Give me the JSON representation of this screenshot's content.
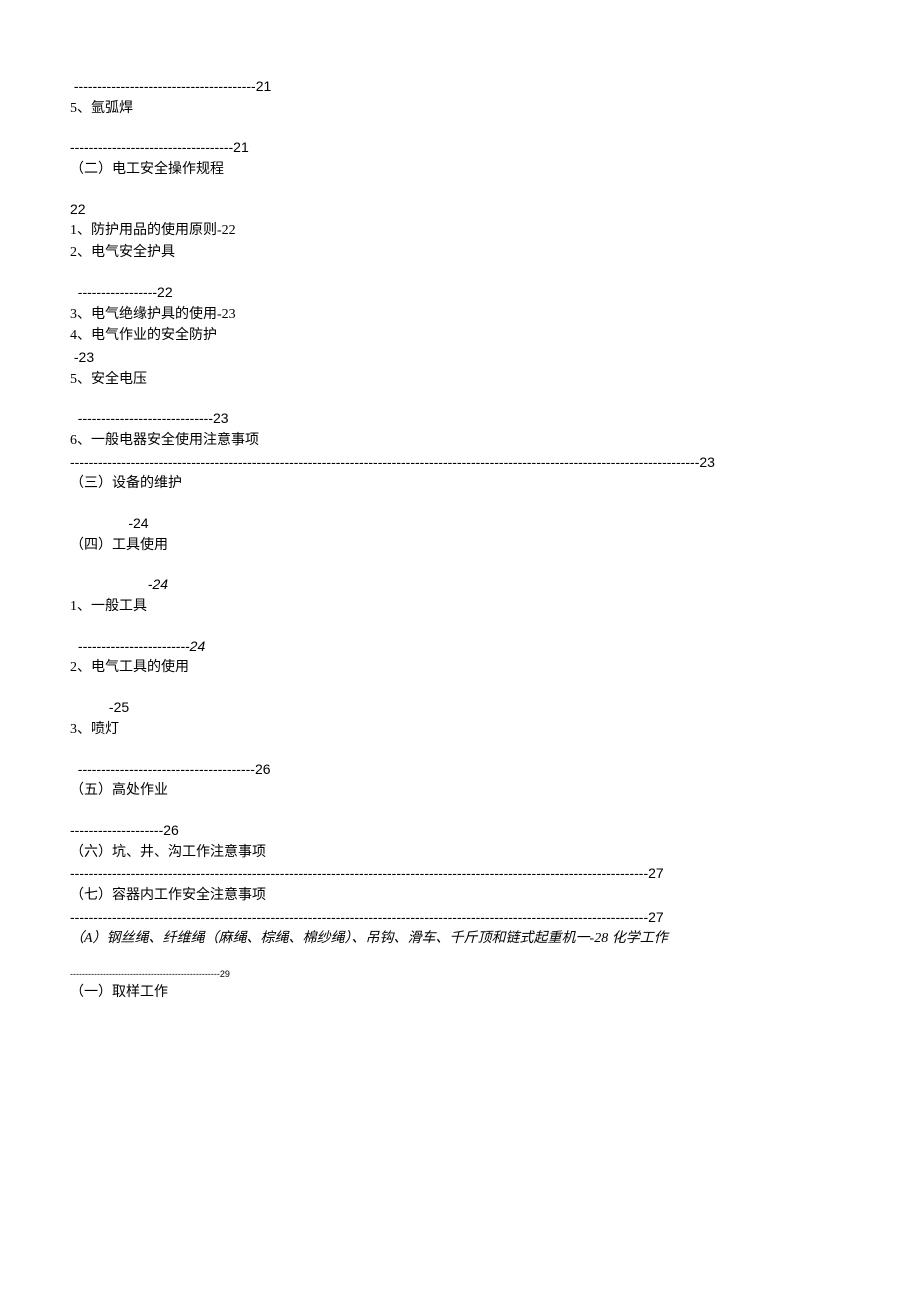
{
  "lines": [
    {
      "text": " ---------------------------------------21",
      "cls": "arial"
    },
    {
      "text": "5、氩弧焊",
      "pre": ""
    },
    {
      "gap": true
    },
    {
      "text": "-----------------------------------21",
      "cls": "arial"
    },
    {
      "text": "（二）电工安全操作规程"
    },
    {
      "gap": true
    },
    {
      "text": "22",
      "cls": "arial"
    },
    {
      "text": "1、防护用品的使用原则-22"
    },
    {
      "text": "2、电气安全护具"
    },
    {
      "gap": true
    },
    {
      "text": "  -----------------22",
      "cls": "arial"
    },
    {
      "text": "3、电气绝缘护具的使用-23"
    },
    {
      "text": "4、电气作业的安全防护"
    },
    {
      "text": " -23",
      "cls": "arial"
    },
    {
      "text": "5、安全电压"
    },
    {
      "gap": true
    },
    {
      "text": "  -----------------------------23",
      "cls": "arial"
    },
    {
      "text": "6、一般电器安全使用注意事项"
    },
    {
      "text": "  ---------------------------------------------------------------------------------------------------------------------------------------23",
      "cls": "arial dashed-full"
    },
    {
      "text": "（三）设备的维护"
    },
    {
      "gap": true
    },
    {
      "text": "               -24",
      "cls": "arial"
    },
    {
      "text": "（四）工具使用"
    },
    {
      "gap": true
    },
    {
      "text": "                    -24",
      "cls": "arial italic"
    },
    {
      "text": "1、一般工具"
    },
    {
      "gap": true
    },
    {
      "text": "  ------------------------24",
      "cls": "arial italic"
    },
    {
      "text": "2、电气工具的使用"
    },
    {
      "gap": true
    },
    {
      "text": "          -25",
      "cls": "arial"
    },
    {
      "text": "3、喷灯"
    },
    {
      "gap": true
    },
    {
      "text": "  --------------------------------------26",
      "cls": "arial"
    },
    {
      "text": "（五）高处作业"
    },
    {
      "gap": true
    },
    {
      "text": "--------------------26",
      "cls": "arial"
    },
    {
      "text": "（六）坑、井、沟工作注意事项"
    },
    {
      "text": " ----------------------------------------------------------------------------------------------------------------------------27",
      "cls": "arial dashed-full"
    },
    {
      "text": "（七）容器内工作安全注意事项"
    },
    {
      "text": " ----------------------------------------------------------------------------------------------------------------------------27",
      "cls": "arial dashed-full"
    },
    {
      "text": "（A）钢丝绳、纤维绳（麻绳、棕绳、棉纱绳）、吊钩、滑车、千斤顶和链式起重机一-28 化学工作",
      "cls": "times italic"
    },
    {
      "gap": true
    },
    {
      "text": "--------------------------------------------------29",
      "cls": "smallline"
    },
    {
      "text": "（一）取样工作"
    }
  ]
}
